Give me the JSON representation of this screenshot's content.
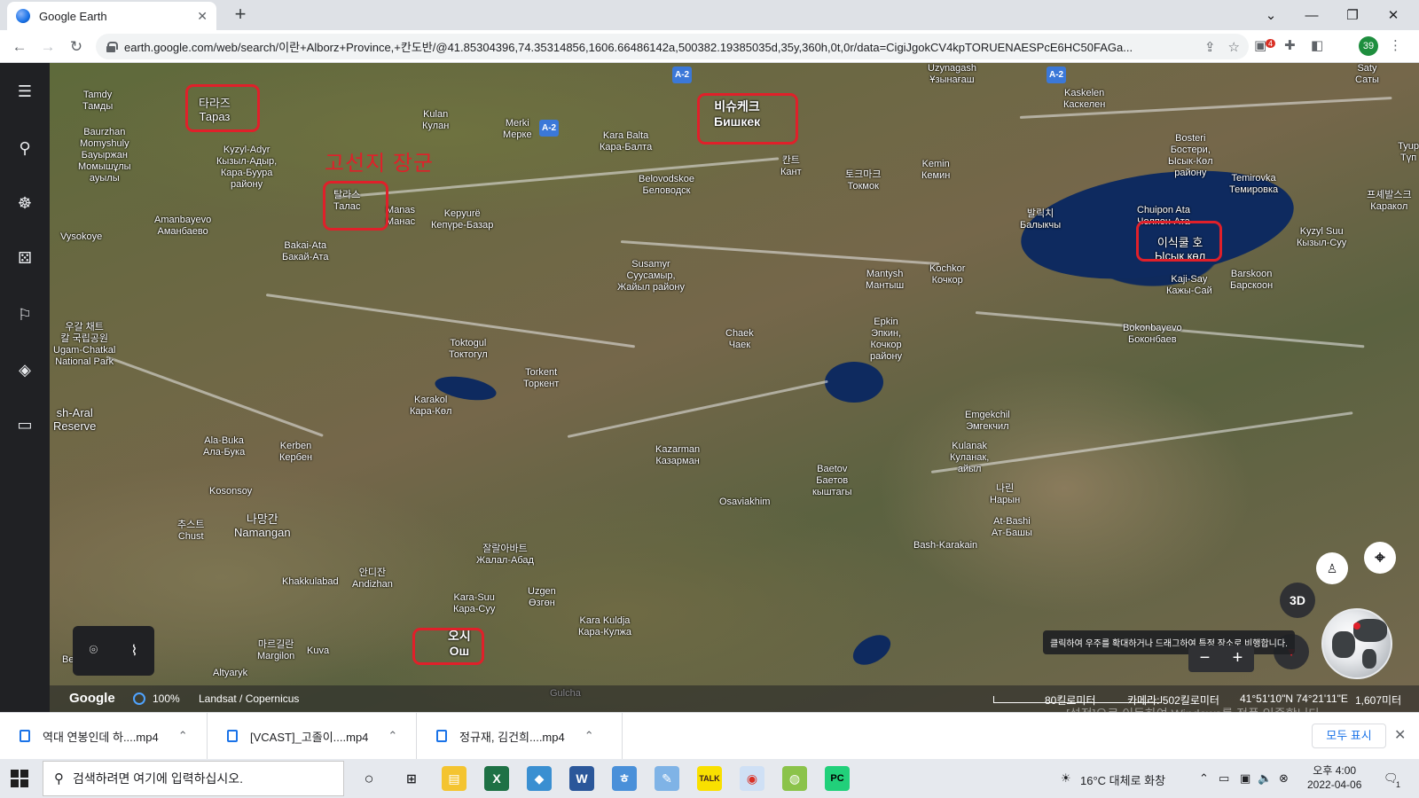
{
  "browser": {
    "tab_title": "Google Earth",
    "tab_close": "✕",
    "new_tab": "+",
    "window_controls": [
      "⌄",
      "—",
      "❐",
      "✕"
    ],
    "url": "earth.google.com/web/search/이란+Alborz+Province,+칸도반/@41.85304396,74.35314856,1606.66486142a,500382.19385035d,35y,360h,0t,0r/data=CigiJgokCV4kpTORUENAESPcE6HC50FAGa...",
    "extension_badge": "4",
    "profile_badge": "39"
  },
  "sidebar": {
    "icons": [
      "menu-icon",
      "search-icon",
      "voyager-icon",
      "dice-icon",
      "projects-icon",
      "layers-icon",
      "measure-icon"
    ]
  },
  "map": {
    "annotation": "고선지 장군",
    "labels": [
      {
        "text": "Tamdy\nТамды"
      },
      {
        "text": "타라즈\nТараз"
      },
      {
        "text": "Baurzhan\nMomyshuly\nБауыржан\nМомышұлы\nауылы"
      },
      {
        "text": "Kyzyl-Adyr\nКызыл-Адыр,\nКара-Буура\nрайону"
      },
      {
        "text": "Kulan\nКулан"
      },
      {
        "text": "Merki\nМерке"
      },
      {
        "text": "Kara Balta\nКара-Балта"
      },
      {
        "text": "비슈케크\nБишкек"
      },
      {
        "text": "칸트\nКант"
      },
      {
        "text": "Uzynagash\nҰзынағаш"
      },
      {
        "text": "Kaskelen\nКаскелен"
      },
      {
        "text": "Saty\nСаты"
      },
      {
        "text": "Bosteri\nБостери,\nЫсык-Көл\nрайону"
      },
      {
        "text": "Tyup\nТүп"
      },
      {
        "text": "Temirovka\nТемировка"
      },
      {
        "text": "프셰발스크\nКаракол"
      },
      {
        "text": "Kemin\nКемин"
      },
      {
        "text": "토크마크\nТокмок"
      },
      {
        "text": "Belovodskoe\nБеловодск"
      },
      {
        "text": "탈라스\nТалас"
      },
      {
        "text": "Manas\nМанас"
      },
      {
        "text": "Kepyurë\nКепүре-Базар"
      },
      {
        "text": "Amanbayevo\nАманбаево"
      },
      {
        "text": "Vysokoye"
      },
      {
        "text": "Bakai-Ata\nБакай-Ата"
      },
      {
        "text": "Chuipon Ata\nЧолпон-Ата"
      },
      {
        "text": "이식쿨 호\nЫсык көл"
      },
      {
        "text": "발릭치\nБалыкчы"
      },
      {
        "text": "Kyzyl Suu\nКызыл-Суу"
      },
      {
        "text": "Kaji-Say\nКажы-Сай"
      },
      {
        "text": "Barskoon\nБарскоон"
      },
      {
        "text": "Susamyr\nСуусамыр,\nЖайыл району"
      },
      {
        "text": "Mantysh\nМантыш"
      },
      {
        "text": "Kochkor\nКочкор"
      },
      {
        "text": "우갈 채트\n칼 국립공원\nUgam-Chatkal\nNational Park"
      },
      {
        "text": "Chaek\nЧаек"
      },
      {
        "text": "Epkin\nЭпкин,\nКочкор\nрайону"
      },
      {
        "text": "Toktogul\nТоктогул"
      },
      {
        "text": "Torkent\nТоркент"
      },
      {
        "text": "Bokonbayevo\nБоконбаев"
      },
      {
        "text": "Karakol\nКара-Көл"
      },
      {
        "text": "sh-Aral\nReserve"
      },
      {
        "text": "Emgekchil\nЭмгекчил"
      },
      {
        "text": "Ala-Buka\nАла-Бука"
      },
      {
        "text": "Kerben\nКербен"
      },
      {
        "text": "Kazarman\nКазарман"
      },
      {
        "text": "Kulanak\nКуланак,\nайыл"
      },
      {
        "text": "Baetov\nБаетов\nкыштагы"
      },
      {
        "text": "Kosonsoy"
      },
      {
        "text": "나린\nНарын"
      },
      {
        "text": "Osaviakhim"
      },
      {
        "text": "추스트\nChust"
      },
      {
        "text": "나망간\nNamangan"
      },
      {
        "text": "At-Bashi\nАт-Башы"
      },
      {
        "text": "Bash-Karakain"
      },
      {
        "text": "잘랄아바트\nЖалал-Абад"
      },
      {
        "text": "안디잔\nAndizhan"
      },
      {
        "text": "Khakkulabad"
      },
      {
        "text": "Kara-Suu\nКара-Суу"
      },
      {
        "text": "Uzgen\nӨзгөн"
      },
      {
        "text": "Kara Kuldja\nКара-Кулжа"
      },
      {
        "text": "마르길란\nMargilon"
      },
      {
        "text": "Kuva"
      },
      {
        "text": "오시\nОш"
      },
      {
        "text": "Besh"
      },
      {
        "text": "Altyaryk"
      },
      {
        "text": "Gulcha"
      }
    ],
    "highway_shields": [
      "A-2",
      "A-2",
      "A-2"
    ],
    "btn_3d": "3D",
    "tooltip": "클릭하여 우주를 확대하거나 드래그하여 특정 장소로 비행합니다.",
    "zoom_out": "−",
    "zoom_in": "+"
  },
  "bottom_bar": {
    "google": "Google",
    "zoom_pct": "100%",
    "attribution": "Landsat / Copernicus",
    "scale": "80킬로미터",
    "camera": "카메라: 502킬로미터",
    "coords": "41°51'10\"N 74°21'11\"E",
    "elevation": "1,607미터",
    "watermark": "[설정]으로 이동하여 Windows를 정품 인증합니다."
  },
  "downloads": {
    "items": [
      "역대 연봉인데 하....mp4",
      "[VCAST]_고졸이....mp4",
      "정규재, 김건희....mp4"
    ],
    "show_all": "모두 표시"
  },
  "taskbar": {
    "search_placeholder": "검색하려면 여기에 입력하십시오.",
    "weather": "16°C  대체로 화창",
    "time": "오후 4:00",
    "date": "2022-04-06",
    "notif": "1"
  }
}
